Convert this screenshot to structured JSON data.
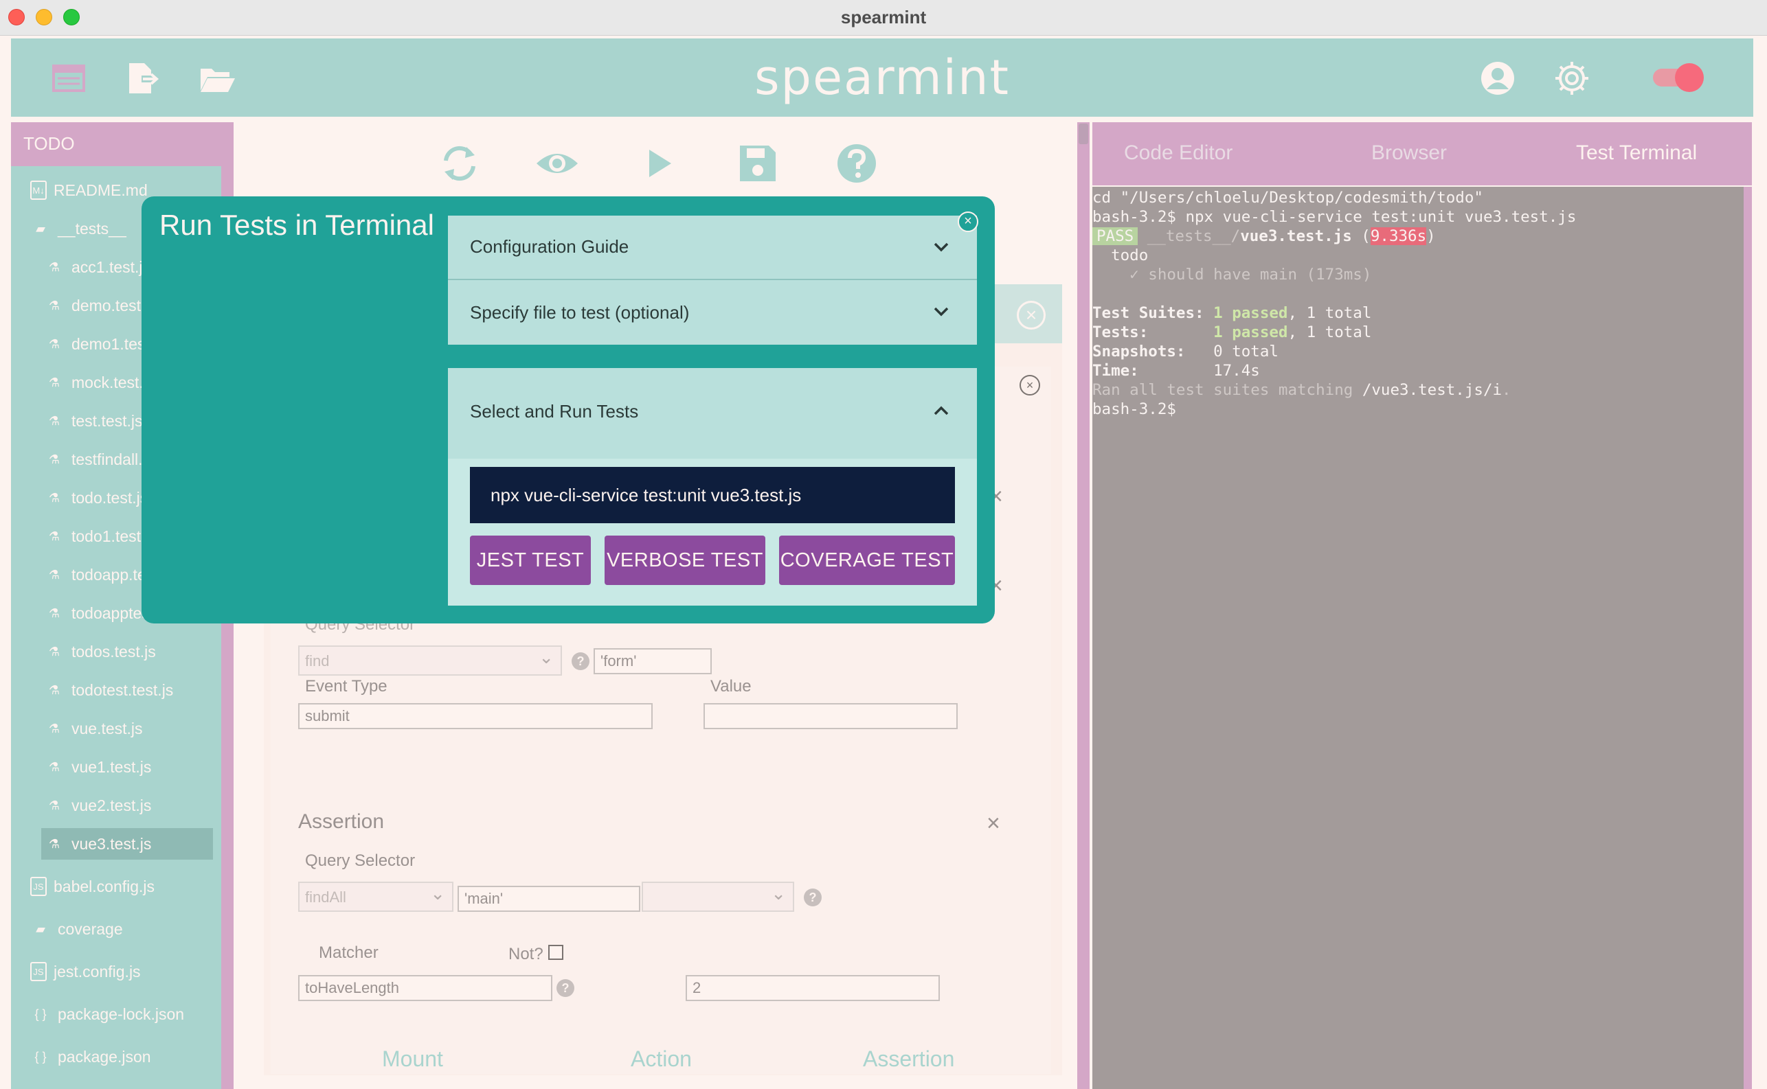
{
  "window": {
    "title": "spearmint"
  },
  "header": {
    "brand": "spearmint"
  },
  "sidebar": {
    "project": "TODO",
    "items": [
      {
        "label": "README.md",
        "icon": "markdown-file-icon",
        "indent": 0
      },
      {
        "label": "__tests__",
        "icon": "folder-open-icon",
        "indent": 0
      },
      {
        "label": "acc1.test.js",
        "icon": "jest-file-icon",
        "indent": 1
      },
      {
        "label": "demo.test.js",
        "icon": "jest-file-icon",
        "indent": 1
      },
      {
        "label": "demo1.test.js",
        "icon": "jest-file-icon",
        "indent": 1
      },
      {
        "label": "mock.test.js",
        "icon": "jest-file-icon",
        "indent": 1
      },
      {
        "label": "test.test.js",
        "icon": "jest-file-icon",
        "indent": 1
      },
      {
        "label": "testfindall.test.js",
        "icon": "jest-file-icon",
        "indent": 1
      },
      {
        "label": "todo.test.js",
        "icon": "jest-file-icon",
        "indent": 1
      },
      {
        "label": "todo1.test.js",
        "icon": "jest-file-icon",
        "indent": 1
      },
      {
        "label": "todoapp.test.js",
        "icon": "jest-file-icon",
        "indent": 1
      },
      {
        "label": "todoapptest.test.js",
        "icon": "jest-file-icon",
        "indent": 1
      },
      {
        "label": "todos.test.js",
        "icon": "jest-file-icon",
        "indent": 1
      },
      {
        "label": "todotest.test.js",
        "icon": "jest-file-icon",
        "indent": 1
      },
      {
        "label": "vue.test.js",
        "icon": "jest-file-icon",
        "indent": 1
      },
      {
        "label": "vue1.test.js",
        "icon": "jest-file-icon",
        "indent": 1
      },
      {
        "label": "vue2.test.js",
        "icon": "jest-file-icon",
        "indent": 1
      },
      {
        "label": "vue3.test.js",
        "icon": "jest-file-icon",
        "indent": 1,
        "selected": true
      },
      {
        "label": "babel.config.js",
        "icon": "js-file-icon",
        "indent": 0
      },
      {
        "label": "coverage",
        "icon": "folder-icon",
        "indent": 0
      },
      {
        "label": "jest.config.js",
        "icon": "js-file-icon",
        "indent": 0
      },
      {
        "label": "package-lock.json",
        "icon": "json-file-icon",
        "indent": 0
      },
      {
        "label": "package.json",
        "icon": "json-file-icon",
        "indent": 0
      }
    ]
  },
  "background_form": {
    "query_selector_label": "Query Selector",
    "query_selector_value": "find",
    "query_arg": "'form'",
    "event_type_label": "Event Type",
    "event_type_value": "submit",
    "value_label": "Value",
    "value_value": "",
    "assertion_title": "Assertion",
    "assert_query_label": "Query Selector",
    "assert_query_value": "findAll",
    "assert_query_arg": "'main'",
    "matcher_label": "Matcher",
    "not_label": "Not?",
    "matcher_value": "toHaveLength",
    "matcher_arg": "2",
    "bottom_tabs": [
      "Mount",
      "Action",
      "Assertion"
    ]
  },
  "modal": {
    "title": "Run Tests in Terminal",
    "accordions": [
      {
        "label": "Configuration Guide",
        "expanded": false
      },
      {
        "label": "Specify file to test (optional)",
        "expanded": false
      },
      {
        "label": "Select and Run Tests",
        "expanded": true
      }
    ],
    "command": "npx vue-cli-service test:unit vue3.test.js",
    "buttons": [
      "JEST TEST",
      "VERBOSE TEST",
      "COVERAGE TEST"
    ]
  },
  "right_panel": {
    "tabs": [
      "Code Editor",
      "Browser",
      "Test Terminal"
    ],
    "active_tab": "Test Terminal"
  },
  "terminal": {
    "cd": "cd \"/Users/chloelu/Desktop/codesmith/todo\"",
    "cmd": "bash-3.2$ npx vue-cli-service test:unit vue3.test.js",
    "pass": "PASS",
    "test_dir": " __tests__/",
    "test_file": "vue3.test.js",
    "time_open": " (",
    "time": "9.336s",
    "time_close": ")",
    "suite": "  todo",
    "case": "    ✓ should have main (173ms)",
    "suites_label": "Test Suites: ",
    "suites_passed": "1 passed",
    "suites_total": ", 1 total",
    "tests_label": "Tests:       ",
    "tests_passed": "1 passed",
    "tests_total": ", 1 total",
    "snapshots_label": "Snapshots:   ",
    "snapshots_value": "0 total",
    "time_label": "Time:        ",
    "time_value": "17.4s",
    "ran_prefix": "Ran all test suites matching ",
    "ran_pattern": "/vue3.test.js/i",
    "ran_suffix": ".",
    "prompt": "bash-3.2$"
  },
  "colors": {
    "mint": "#a9d4ce",
    "pink": "#d4a7c7",
    "teal": "#20a298",
    "purple": "#8c4b9e",
    "navy": "#0e1e3d",
    "terminal_bg": "#a39b9a"
  }
}
